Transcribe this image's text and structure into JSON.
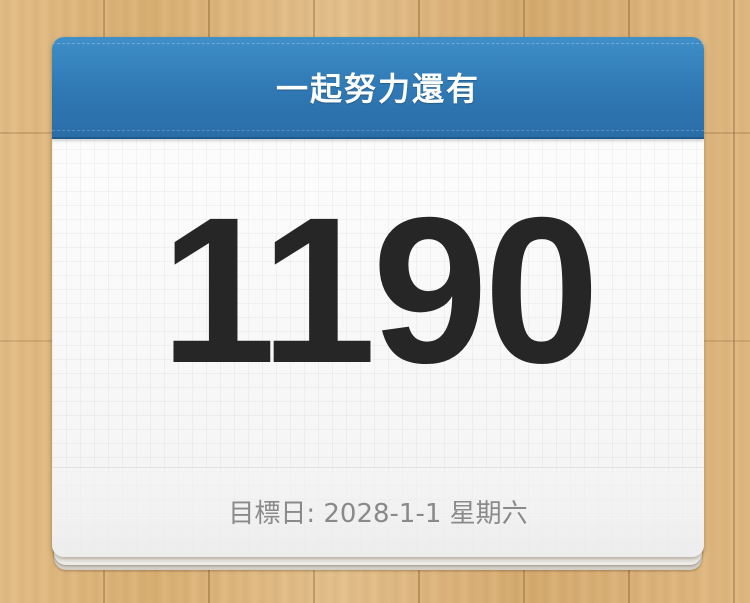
{
  "header": {
    "title": "一起努力還有"
  },
  "countdown": {
    "days": "1190"
  },
  "footer": {
    "target_date": "目標日: 2028-1-1 星期六"
  },
  "colors": {
    "header_blue": "#2f78b3",
    "number_text": "#262626",
    "footer_text": "#8a8a8a",
    "background_wood": "#ddb57a"
  }
}
